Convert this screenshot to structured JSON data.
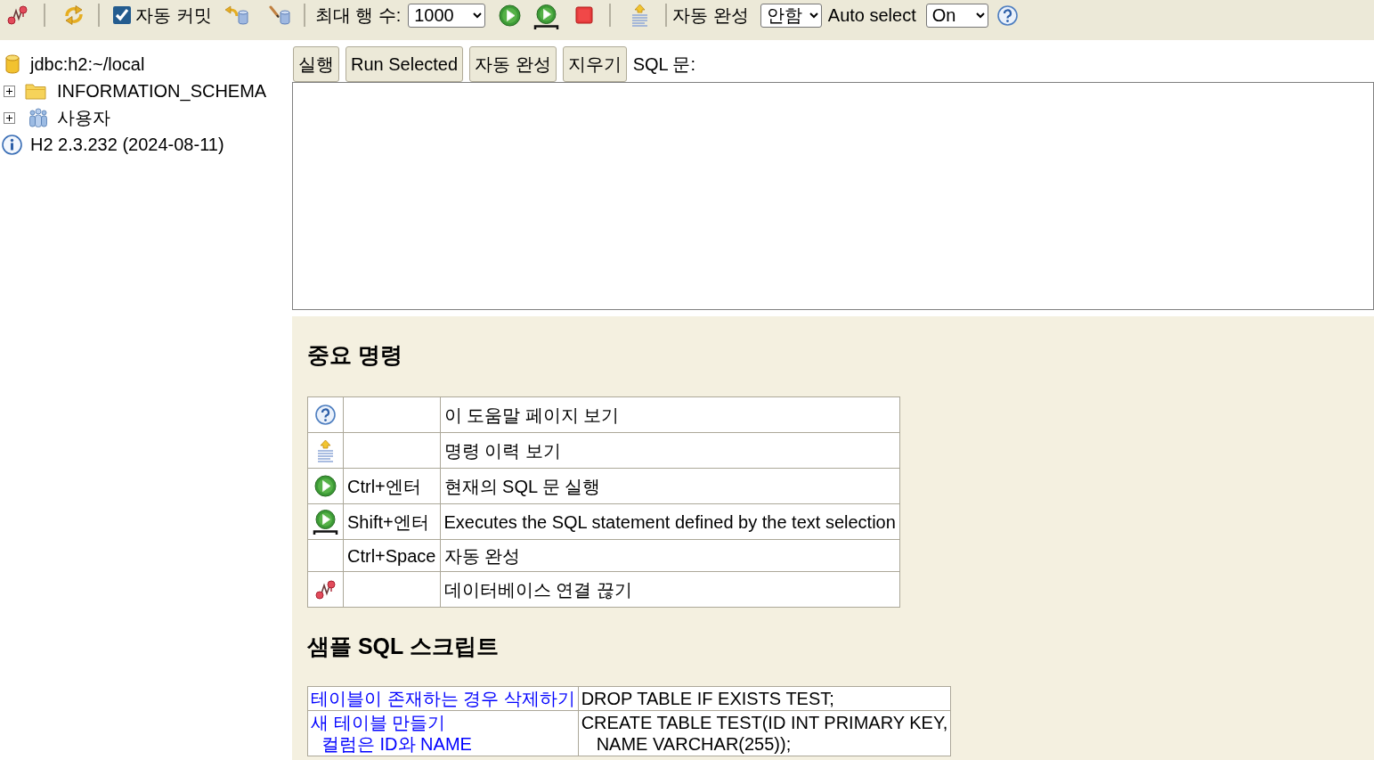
{
  "toolbar": {
    "auto_commit": {
      "label": "자동 커밋",
      "checked": true
    },
    "max_rows": {
      "label": "최대 행 수:",
      "value": "1000"
    },
    "autocomplete": {
      "label": "자동 완성",
      "value": "안함"
    },
    "auto_select": {
      "label": "Auto select",
      "value": "On"
    }
  },
  "tree": [
    {
      "kind": "database",
      "label": "jdbc:h2:~/local",
      "children": [
        {
          "kind": "schema",
          "label": "INFORMATION_SCHEMA",
          "expanded": false
        },
        {
          "kind": "users",
          "label": "사용자",
          "expanded": false
        }
      ]
    },
    {
      "kind": "info",
      "label": "H2 2.3.232 (2024-08-11)"
    }
  ],
  "query": {
    "buttons": [
      "실행",
      "Run Selected",
      "자동 완성",
      "지우기"
    ],
    "sql_label": "SQL 문:"
  },
  "help": {
    "title": "중요 명령",
    "rows": [
      {
        "kind": "help",
        "description": "이 도움말 페이지 보기"
      },
      {
        "kind": "history",
        "description": "명령 이력 보기"
      },
      {
        "kind": "run",
        "shortcut": "Ctrl+엔터",
        "description": "현재의 SQL 문 실행"
      },
      {
        "kind": "runselected",
        "shortcut": "Shift+엔터",
        "description": "Executes the SQL statement defined by the text selection"
      },
      {
        "kind": "complete",
        "shortcut": "Ctrl+Space",
        "description": "자동 완성"
      },
      {
        "kind": "disconnect",
        "description": "데이터베이스 연결 끊기"
      }
    ]
  },
  "samples": {
    "title": "샘플 SQL 스크립트",
    "rows": [
      {
        "action": [
          "테이블이 존재하는 경우 삭제하기"
        ],
        "sql": [
          "DROP TABLE IF EXISTS TEST;"
        ]
      },
      {
        "action": [
          "새 테이블 만들기",
          "컬럼은 ID와 NAME"
        ],
        "sql": [
          "CREATE TABLE TEST(ID INT PRIMARY KEY,",
          "NAME VARCHAR(255));"
        ]
      }
    ]
  }
}
